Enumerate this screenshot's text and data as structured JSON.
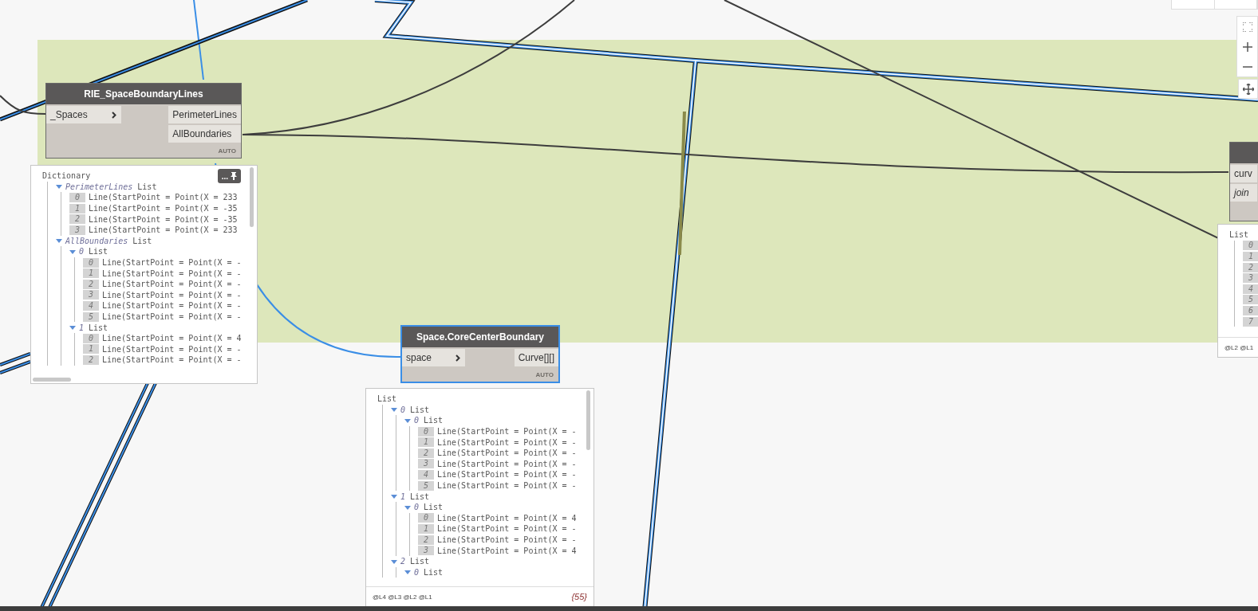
{
  "nodes": [
    {
      "title": "RIE_SpaceBoundaryLines",
      "selected": false,
      "inputs": [
        {
          "label": "_Spaces",
          "italic": false,
          "chevron": true
        }
      ],
      "outputs": [
        "PerimeterLines",
        "AllBoundaries"
      ],
      "lacing": "AUTO",
      "watch": {
        "root": "Dictionary",
        "pin_button": "...",
        "items": [
          {
            "kind": "branch",
            "label": "PerimeterLines",
            "type": "List",
            "children": [
              {
                "kind": "leaf",
                "index": "0",
                "text": "Line(StartPoint = Point(X = 233"
              },
              {
                "kind": "leaf",
                "index": "1",
                "text": "Line(StartPoint = Point(X = -35"
              },
              {
                "kind": "leaf",
                "index": "2",
                "text": "Line(StartPoint = Point(X = -35"
              },
              {
                "kind": "leaf",
                "index": "3",
                "text": "Line(StartPoint = Point(X = 233"
              }
            ]
          },
          {
            "kind": "branch",
            "label": "AllBoundaries",
            "type": "List",
            "children": [
              {
                "kind": "branch",
                "label": "0",
                "type": "List",
                "children": [
                  {
                    "kind": "leaf",
                    "index": "0",
                    "text": "Line(StartPoint = Point(X = -"
                  },
                  {
                    "kind": "leaf",
                    "index": "1",
                    "text": "Line(StartPoint = Point(X = -"
                  },
                  {
                    "kind": "leaf",
                    "index": "2",
                    "text": "Line(StartPoint = Point(X = -"
                  },
                  {
                    "kind": "leaf",
                    "index": "3",
                    "text": "Line(StartPoint = Point(X = -"
                  },
                  {
                    "kind": "leaf",
                    "index": "4",
                    "text": "Line(StartPoint = Point(X = -"
                  },
                  {
                    "kind": "leaf",
                    "index": "5",
                    "text": "Line(StartPoint = Point(X = -"
                  }
                ]
              },
              {
                "kind": "branch",
                "label": "1",
                "type": "List",
                "children": [
                  {
                    "kind": "leaf",
                    "index": "0",
                    "text": "Line(StartPoint = Point(X = 4"
                  },
                  {
                    "kind": "leaf",
                    "index": "1",
                    "text": "Line(StartPoint = Point(X = -"
                  },
                  {
                    "kind": "leaf",
                    "index": "2",
                    "text": "Line(StartPoint = Point(X = -"
                  }
                ]
              }
            ]
          }
        ]
      }
    },
    {
      "title": "Space.CoreCenterBoundary",
      "selected": true,
      "inputs": [
        {
          "label": "space",
          "italic": false,
          "chevron": true
        }
      ],
      "outputs": [
        "Curve[][]"
      ],
      "lacing": "AUTO",
      "watch": {
        "root": "List",
        "levels": "@L4 @L3 @L2 @L1",
        "count": "{55}",
        "items": [
          {
            "kind": "branch",
            "label": "0",
            "type": "List",
            "children": [
              {
                "kind": "branch",
                "label": "0",
                "type": "List",
                "children": [
                  {
                    "kind": "leaf",
                    "index": "0",
                    "text": "Line(StartPoint = Point(X = -"
                  },
                  {
                    "kind": "leaf",
                    "index": "1",
                    "text": "Line(StartPoint = Point(X = -"
                  },
                  {
                    "kind": "leaf",
                    "index": "2",
                    "text": "Line(StartPoint = Point(X = -"
                  },
                  {
                    "kind": "leaf",
                    "index": "3",
                    "text": "Line(StartPoint = Point(X = -"
                  },
                  {
                    "kind": "leaf",
                    "index": "4",
                    "text": "Line(StartPoint = Point(X = -"
                  },
                  {
                    "kind": "leaf",
                    "index": "5",
                    "text": "Line(StartPoint = Point(X = -"
                  }
                ]
              }
            ]
          },
          {
            "kind": "branch",
            "label": "1",
            "type": "List",
            "children": [
              {
                "kind": "branch",
                "label": "0",
                "type": "List",
                "children": [
                  {
                    "kind": "leaf",
                    "index": "0",
                    "text": "Line(StartPoint = Point(X = 4"
                  },
                  {
                    "kind": "leaf",
                    "index": "1",
                    "text": "Line(StartPoint = Point(X = -"
                  },
                  {
                    "kind": "leaf",
                    "index": "2",
                    "text": "Line(StartPoint = Point(X = -"
                  },
                  {
                    "kind": "leaf",
                    "index": "3",
                    "text": "Line(StartPoint = Point(X = 4"
                  }
                ]
              }
            ]
          },
          {
            "kind": "branch",
            "label": "2",
            "type": "List",
            "children": [
              {
                "kind": "branch",
                "label": "0",
                "type": "List"
              }
            ]
          }
        ]
      }
    },
    {
      "selected": false,
      "inputs": [
        {
          "label": "curv",
          "italic": false,
          "chevron": false
        },
        {
          "label": "join",
          "italic": true,
          "chevron": false
        }
      ],
      "watch": {
        "root": "List",
        "levels": "@L2 @L1",
        "items": [
          {
            "kind": "leaf",
            "index": "0"
          },
          {
            "kind": "leaf",
            "index": "1"
          },
          {
            "kind": "leaf",
            "index": "2"
          },
          {
            "kind": "leaf",
            "index": "3"
          },
          {
            "kind": "leaf",
            "index": "4"
          },
          {
            "kind": "leaf",
            "index": "5"
          },
          {
            "kind": "leaf",
            "index": "6"
          },
          {
            "kind": "leaf",
            "index": "7"
          }
        ]
      }
    }
  ]
}
